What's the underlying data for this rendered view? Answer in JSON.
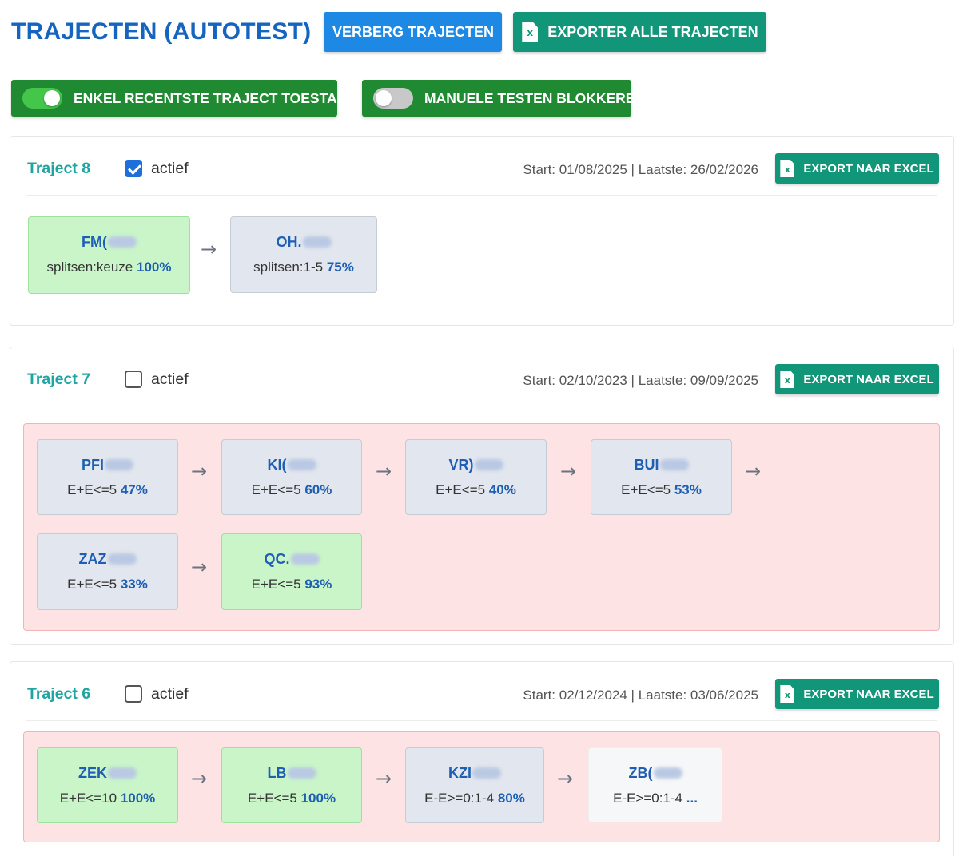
{
  "header": {
    "title": "TRAJECTEN (AUTOTEST)",
    "hide_button": "VERBERG TRAJECTEN",
    "export_all_button": "EXPORTER ALLE TRAJECTEN"
  },
  "toggles": [
    {
      "label": "ENKEL RECENTSTE TRAJECT TOESTAAN",
      "on": true
    },
    {
      "label": "MANUELE TESTEN BLOKKEREN",
      "on": false
    }
  ],
  "export_label": "EXPORT NAAR EXCEL",
  "active_label": "actief",
  "trajects": [
    {
      "title": "Traject 8",
      "active": true,
      "dates": "Start: 01/08/2025  |  Laatste: 26/02/2026",
      "highlighted": false,
      "steps": [
        {
          "code": "FM(",
          "detail": "splitsen:keuze",
          "pct": "100%",
          "state": "green"
        },
        {
          "code": "OH.",
          "detail": "splitsen:1-5",
          "pct": "75%",
          "state": "grey"
        }
      ]
    },
    {
      "title": "Traject 7",
      "active": false,
      "dates": "Start: 02/10/2023  |  Laatste: 09/09/2025",
      "highlighted": true,
      "steps": [
        {
          "code": "PFI",
          "detail": "E+E<=5",
          "pct": "47%",
          "state": "grey"
        },
        {
          "code": "KI(",
          "detail": "E+E<=5",
          "pct": "60%",
          "state": "grey"
        },
        {
          "code": "VR)",
          "detail": "E+E<=5",
          "pct": "40%",
          "state": "grey"
        },
        {
          "code": "BUI",
          "detail": "E+E<=5",
          "pct": "53%",
          "state": "grey"
        },
        {
          "code": "ZAZ",
          "detail": "E+E<=5",
          "pct": "33%",
          "state": "grey"
        },
        {
          "code": "QC.",
          "detail": "E+E<=5",
          "pct": "93%",
          "state": "green"
        }
      ]
    },
    {
      "title": "Traject 6",
      "active": false,
      "dates": "Start: 02/12/2024  |  Laatste: 03/06/2025",
      "highlighted": true,
      "steps": [
        {
          "code": "ZEK",
          "detail": "E+E<=10",
          "pct": "100%",
          "state": "green"
        },
        {
          "code": "LB",
          "detail": "E+E<=5",
          "pct": "100%",
          "state": "green"
        },
        {
          "code": "KZI",
          "detail": "E-E>=0:1-4",
          "pct": "80%",
          "state": "grey"
        },
        {
          "code": "ZB(",
          "detail": "E-E>=0:1-4",
          "pct": "...",
          "state": "white"
        }
      ]
    }
  ],
  "colors": {
    "title_blue": "#1565c0",
    "button_blue": "#1e88e5",
    "button_teal": "#11967a",
    "toggle_green": "#1f8a32",
    "traject_title": "#1fa5a0",
    "step_green": "#c9f5c9",
    "step_grey": "#e2e6ee",
    "highlight_bg": "#fde3e4"
  }
}
